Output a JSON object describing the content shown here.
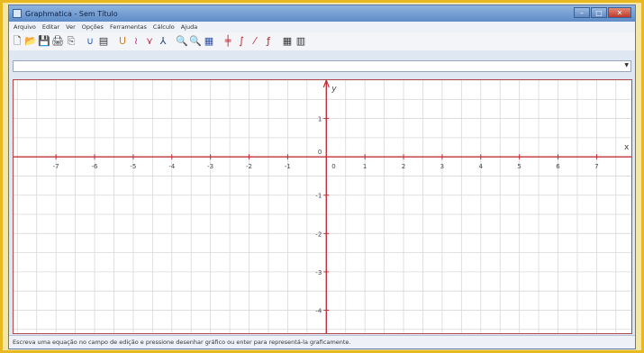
{
  "window": {
    "title": "Graphmatica - Sem Título"
  },
  "titlebar_buttons": {
    "minimize": "–",
    "maximize": "□",
    "close": "✕"
  },
  "menubar": [
    {
      "label": "Arquivo"
    },
    {
      "label": "Editar"
    },
    {
      "label": "Ver"
    },
    {
      "label": "Opções"
    },
    {
      "label": "Ferramentas"
    },
    {
      "label": "Cálculo"
    },
    {
      "label": "Ajuda"
    }
  ],
  "toolbar": [
    {
      "name": "new-file-icon",
      "glyph": "🗋",
      "color": "#333333"
    },
    {
      "name": "open-folder-icon",
      "glyph": "📂",
      "color": "#d8a018"
    },
    {
      "name": "save-icon",
      "glyph": "💾",
      "color": "#3358a8"
    },
    {
      "name": "print-icon",
      "glyph": "🖨",
      "color": "#333333"
    },
    {
      "name": "copy-icon",
      "glyph": "⎘",
      "color": "#555555"
    },
    {
      "name": "parabola-icon",
      "glyph": "∪",
      "color": "#2060c0"
    },
    {
      "name": "table-icon",
      "glyph": "▤",
      "color": "#333333"
    },
    {
      "name": "graph-curve-icon",
      "glyph": "ᑌ",
      "color": "#d08020"
    },
    {
      "name": "graph-wave-icon",
      "glyph": "≀",
      "color": "#c02080"
    },
    {
      "name": "graph-derivative-icon",
      "glyph": "⋎",
      "color": "#c02040"
    },
    {
      "name": "graph-point-icon",
      "glyph": "⅄",
      "color": "#204080"
    },
    {
      "name": "zoom-in-icon",
      "glyph": "🔍",
      "color": "#333333"
    },
    {
      "name": "zoom-out-icon",
      "glyph": "🔍",
      "color": "#333333"
    },
    {
      "name": "zoom-box-icon",
      "glyph": "▦",
      "color": "#3050a0"
    },
    {
      "name": "axes-icon",
      "glyph": "╪",
      "color": "#c02020"
    },
    {
      "name": "integral-icon",
      "glyph": "∫",
      "color": "#c02020"
    },
    {
      "name": "tangent-icon",
      "glyph": "⁄",
      "color": "#c02020"
    },
    {
      "name": "function-icon",
      "glyph": "ƒ",
      "color": "#c02020"
    },
    {
      "name": "grid-icon",
      "glyph": "▦",
      "color": "#333333"
    },
    {
      "name": "panel-icon",
      "glyph": "▥",
      "color": "#333333"
    }
  ],
  "equation_input": {
    "value": "",
    "placeholder": ""
  },
  "graph": {
    "xlabel": "x",
    "ylabel": "y",
    "x_ticks": [
      "-7",
      "-6",
      "-5",
      "-4",
      "-3",
      "-2",
      "-1",
      "0",
      "1",
      "2",
      "3",
      "4",
      "5",
      "6",
      "7"
    ],
    "y_ticks": [
      "1",
      "0",
      "-1",
      "-2",
      "-3",
      "-4"
    ],
    "xlim": [
      -8.1,
      7.9
    ],
    "ylim": [
      -4.6,
      2
    ],
    "colors": {
      "axis": "#c0303a",
      "grid": "#d8d8d8",
      "label": "#444444"
    }
  },
  "statusbar": {
    "text": "Escreva uma equação no campo de edição e pressione desenhar gráfico ou enter para representá-la graficamente."
  }
}
